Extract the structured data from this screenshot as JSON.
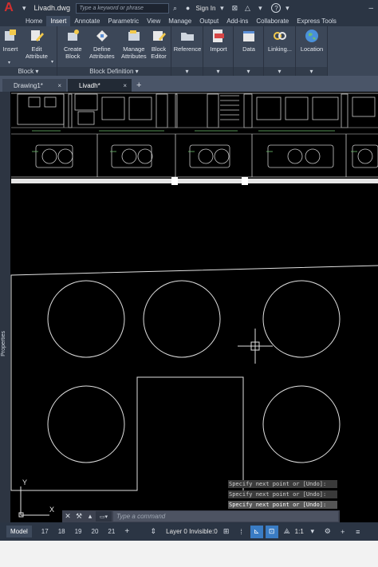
{
  "app": {
    "logo": "A",
    "document_title": "Livadh.dwg"
  },
  "search": {
    "placeholder": "Type a keyword or phrase"
  },
  "account": {
    "signin_label": "Sign In",
    "help_label": "?"
  },
  "ribbon_tabs": [
    "Home",
    "Insert",
    "Annotate",
    "Parametric",
    "View",
    "Manage",
    "Output",
    "Add-ins",
    "Collaborate",
    "Express Tools"
  ],
  "active_ribbon_tab": "Insert",
  "ribbon": {
    "insert": "Insert",
    "edit_attribute_1": "Edit",
    "edit_attribute_2": "Attribute",
    "block_panel": "Block",
    "create_block_1": "Create",
    "create_block_2": "Block",
    "define_attributes_1": "Define",
    "define_attributes_2": "Attributes",
    "manage_attributes_1": "Manage",
    "manage_attributes_2": "Attributes",
    "block_editor_1": "Block",
    "block_editor_2": "Editor",
    "block_definition_panel": "Block Definition",
    "reference": "Reference",
    "import": "Import",
    "data": "Data",
    "linking": "Linking...",
    "location": "Location"
  },
  "doc_tabs": [
    {
      "label": "Drawing1*",
      "close": "×"
    },
    {
      "label": "Livadh*",
      "close": "×"
    }
  ],
  "side_palette": {
    "label": "Properties"
  },
  "command": {
    "history": [
      "Specify next point or [Undo]:",
      "Specify next point or [Undo]:",
      "Specify next point or [Undo]:"
    ],
    "placeholder": "Type a command"
  },
  "ucs": {
    "x_label": "X",
    "y_label": "Y"
  },
  "status": {
    "layout_tabs": [
      "Model",
      "17",
      "18",
      "19",
      "20",
      "21"
    ],
    "layer_text": "Layer 0 Invisible:0",
    "scale": "1:1",
    "add": "+"
  },
  "colors": {
    "title_bar": "#2b3544",
    "ribbon": "#3c4758",
    "canvas": "#000000",
    "logo_red": "#d32f2f",
    "active_toggle": "#3a7cc4"
  }
}
